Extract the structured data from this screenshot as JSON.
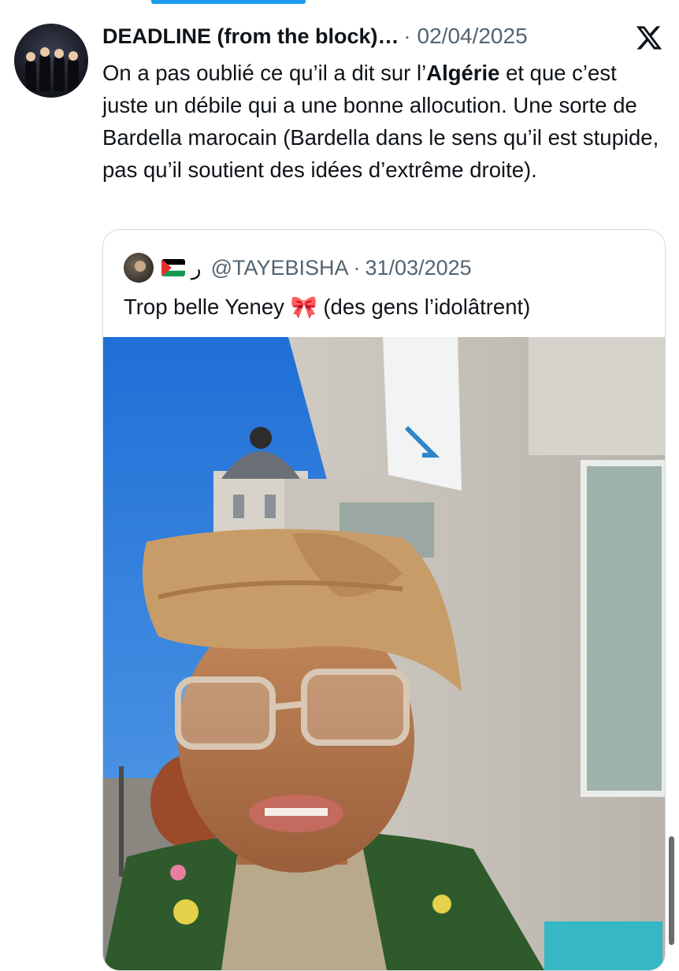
{
  "tweet": {
    "author_name": "DEADLINE (from the block)…",
    "separator": "·",
    "date": "02/04/2025",
    "text_before": "On a pas oublié ce qu’il a dit sur l’",
    "text_bold": "Algérie",
    "text_after": " et que c’est juste un débile qui a une bonne allocution. Une sorte de Bardella marocain (Bardella dans le sens qu’il est stupide, pas qu’il soutient des idées d’extrême droite)."
  },
  "quote": {
    "name": "ر",
    "handle": "@TAYEBISHA",
    "separator": "·",
    "date": "31/03/2025",
    "text": "Trop belle Yeney 🎀 (des gens l’idolâtrent)"
  },
  "icons": {
    "close": "x-logo-icon",
    "flag": "palestine-flag-icon"
  },
  "colors": {
    "accent": "#1d9bf0",
    "text": "#0f1419",
    "muted": "#536471",
    "border": "#cfd9de"
  }
}
